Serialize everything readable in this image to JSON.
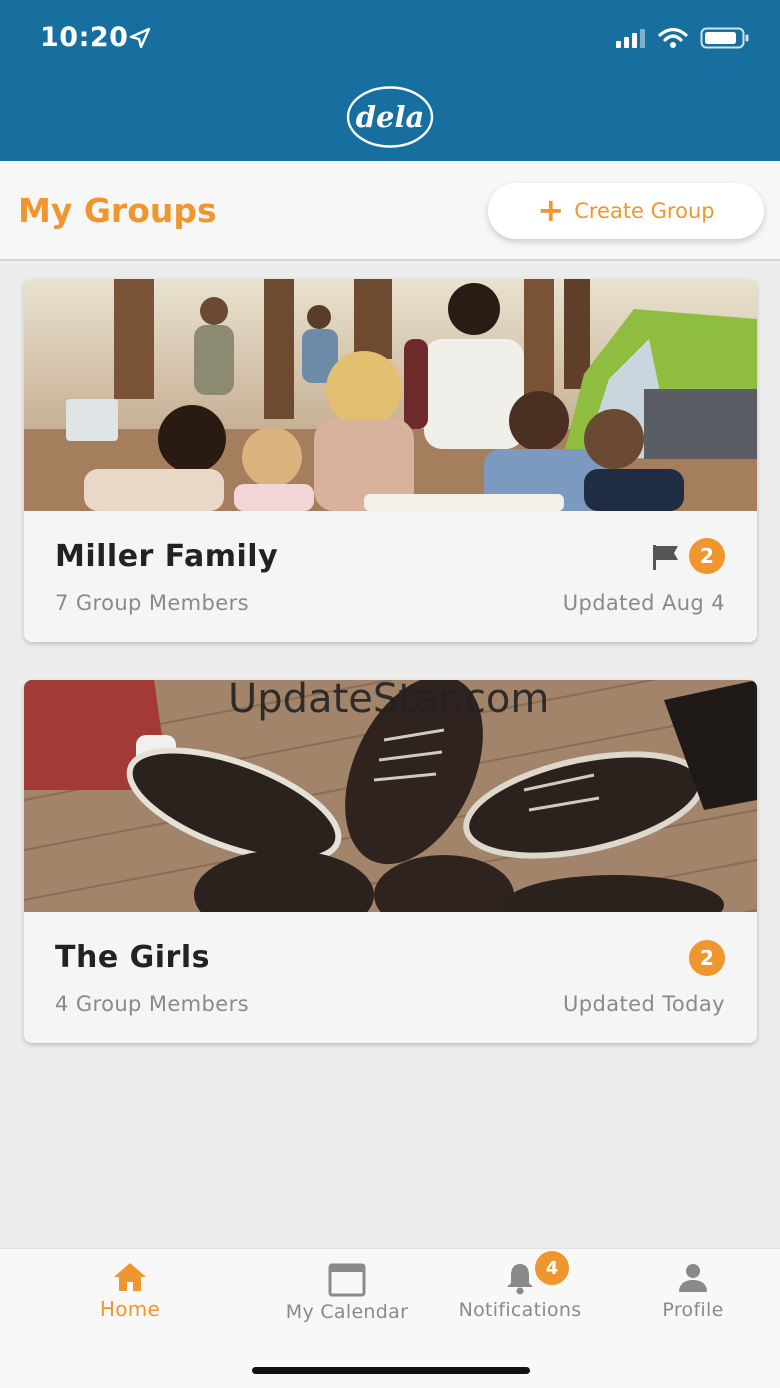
{
  "status_bar": {
    "time": "10:20"
  },
  "header": {
    "logo_text": "dela"
  },
  "groups_header": {
    "title": "My Groups",
    "create_label": "Create Group"
  },
  "groups": [
    {
      "name": "Miller Family",
      "members": "7 Group Members",
      "updated": "Updated Aug 4",
      "badge": "2",
      "flagged": true
    },
    {
      "name": "The Girls",
      "members": "4 Group Members",
      "updated": "Updated Today",
      "badge": "2",
      "flagged": false
    }
  ],
  "watermark": "UpdateStar.com",
  "bottom_nav": {
    "items": [
      {
        "label": "Home",
        "icon": "home-icon",
        "active": true
      },
      {
        "label": "My Calendar",
        "icon": "calendar-icon",
        "active": false
      },
      {
        "label": "Notifications",
        "icon": "bell-icon",
        "active": false,
        "badge": "4"
      },
      {
        "label": "Profile",
        "icon": "person-icon",
        "active": false
      }
    ]
  },
  "colors": {
    "header": "#166f9e",
    "accent": "#f0962f",
    "muted": "#8a8a8a"
  }
}
